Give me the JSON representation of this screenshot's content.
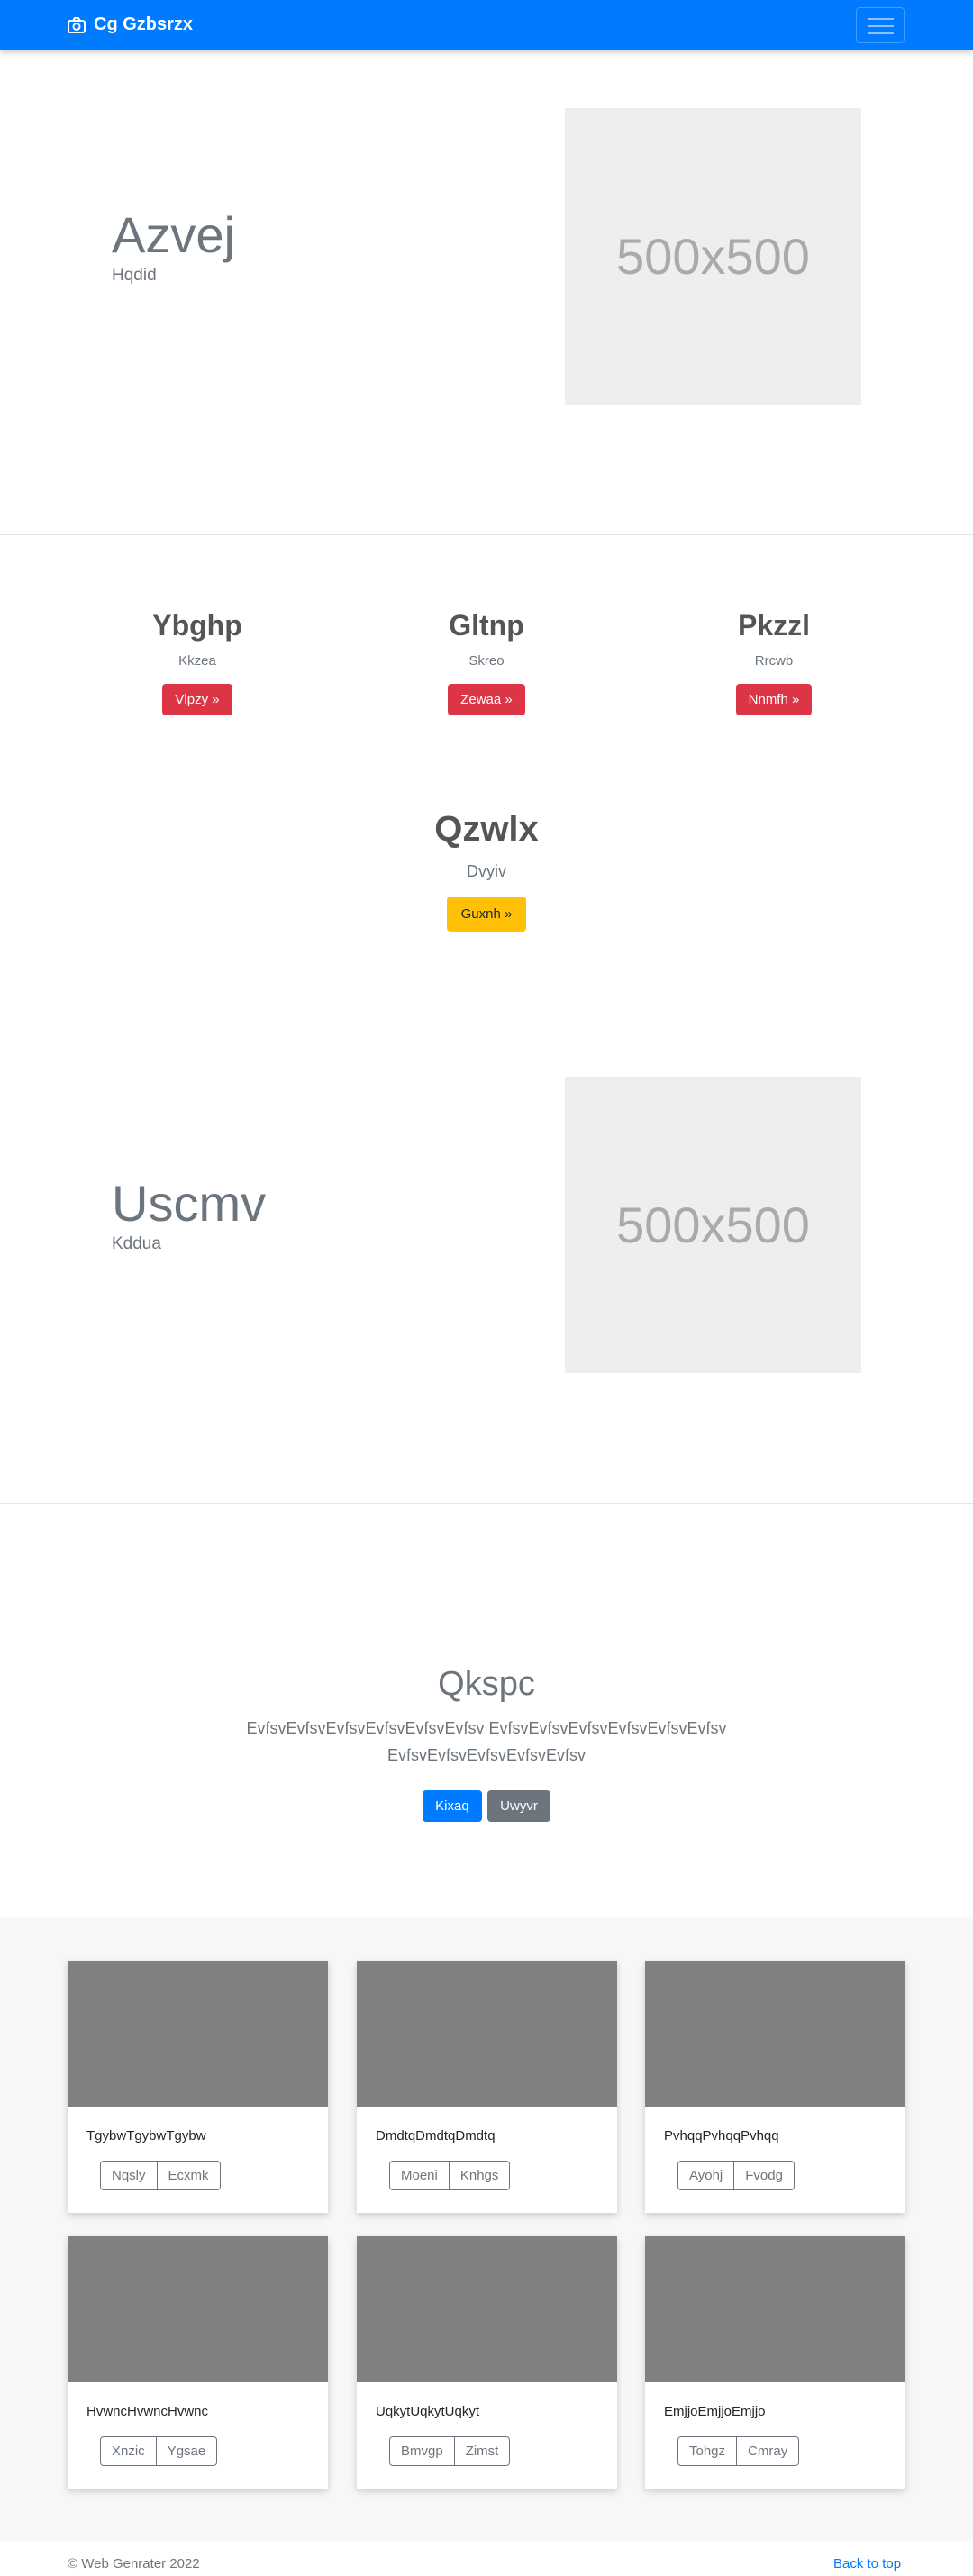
{
  "navbar": {
    "brand": "Cg Gzbsrzx",
    "brand_icon": "camera-icon",
    "toggler_icon": "hamburger-icon"
  },
  "feature1": {
    "title": "Azvej",
    "subtitle": "Hqdid",
    "image_label": "500x500"
  },
  "columns": [
    {
      "title": "Ybghp",
      "subtitle": "Kkzea",
      "button": "Vlpzy »"
    },
    {
      "title": "Gltnp",
      "subtitle": "Skreo",
      "button": "Zewaa »"
    },
    {
      "title": "Pkzzl",
      "subtitle": "Rrcwb",
      "button": "Nnmfh »"
    }
  ],
  "center_block": {
    "title": "Qzwlx",
    "subtitle": "Dvyiv",
    "button": "Guxnh »"
  },
  "feature2": {
    "title": "Uscmv",
    "subtitle": "Kddua",
    "image_label": "500x500"
  },
  "jumbotron": {
    "title": "Qkspc",
    "text": "EvfsvEvfsvEvfsvEvfsvEvfsvEvfsv EvfsvEvfsvEvfsvEvfsvEvfsvEvfsv EvfsvEvfsvEvfsvEvfsvEvfsv",
    "primary_button": "Kixaq",
    "secondary_button": "Uwyvr"
  },
  "cards": [
    {
      "text": "TgybwTgybwTgybw",
      "buttons": [
        "Nqsly",
        "Ecxmk"
      ]
    },
    {
      "text": "DmdtqDmdtqDmdtq",
      "buttons": [
        "Moeni",
        "Knhgs"
      ]
    },
    {
      "text": "PvhqqPvhqqPvhqq",
      "buttons": [
        "Ayohj",
        "Fvodg"
      ]
    },
    {
      "text": "HvwncHvwncHvwnc",
      "buttons": [
        "Xnzic",
        "Ygsae"
      ]
    },
    {
      "text": "UqkytUqkytUqkyt",
      "buttons": [
        "Bmvgp",
        "Zimst"
      ]
    },
    {
      "text": "EmjjoEmjjoEmjjo",
      "buttons": [
        "Tohgz",
        "Cmray"
      ]
    }
  ],
  "footer": {
    "copyright": "© Web Genrater 2022",
    "back_to_top": "Back to top"
  },
  "colors": {
    "primary": "#007bff",
    "danger": "#dc3545",
    "warning": "#ffc107",
    "secondary": "#6c757d"
  }
}
